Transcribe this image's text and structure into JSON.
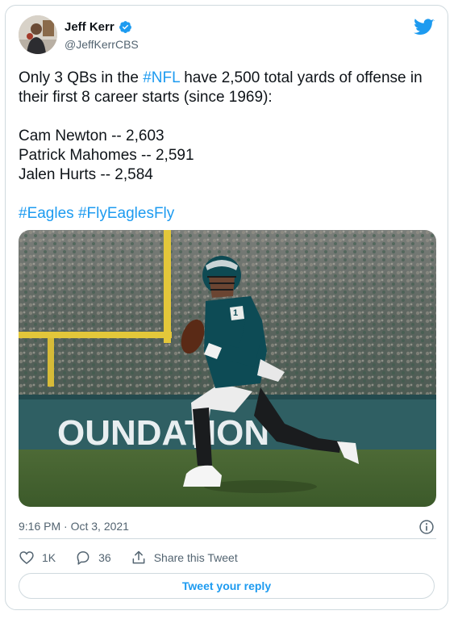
{
  "author": {
    "name": "Jeff Kerr",
    "handle": "@JeffKerrCBS"
  },
  "tweet": {
    "line1": "Only 3 QBs in the ",
    "hashtag_nfl": "#NFL",
    "line1_rest": " have 2,500 total yards of offense in their first 8 career starts (since 1969):",
    "list": [
      "Cam Newton -- 2,603",
      "Patrick Mahomes -- 2,591",
      "Jalen Hurts -- 2,584"
    ],
    "hashtag_eagles": "#Eagles",
    "hashtag_flyeaglesfly": "#FlyEaglesFly"
  },
  "photo": {
    "banner_text": "OUNDATION",
    "jersey_number": "1"
  },
  "timestamp": "9:16 PM · Oct 3, 2021",
  "actions": {
    "likes": "1K",
    "replies": "36",
    "share_label": "Share this Tweet"
  },
  "reply_button_label": "Tweet your reply",
  "colors": {
    "accent": "#1d9bf0",
    "text": "#0f1419",
    "muted": "#536471",
    "border": "#cfd9de"
  },
  "icons": [
    "verified-badge-icon",
    "twitter-bird-icon",
    "info-icon",
    "heart-icon",
    "reply-icon",
    "share-icon"
  ]
}
